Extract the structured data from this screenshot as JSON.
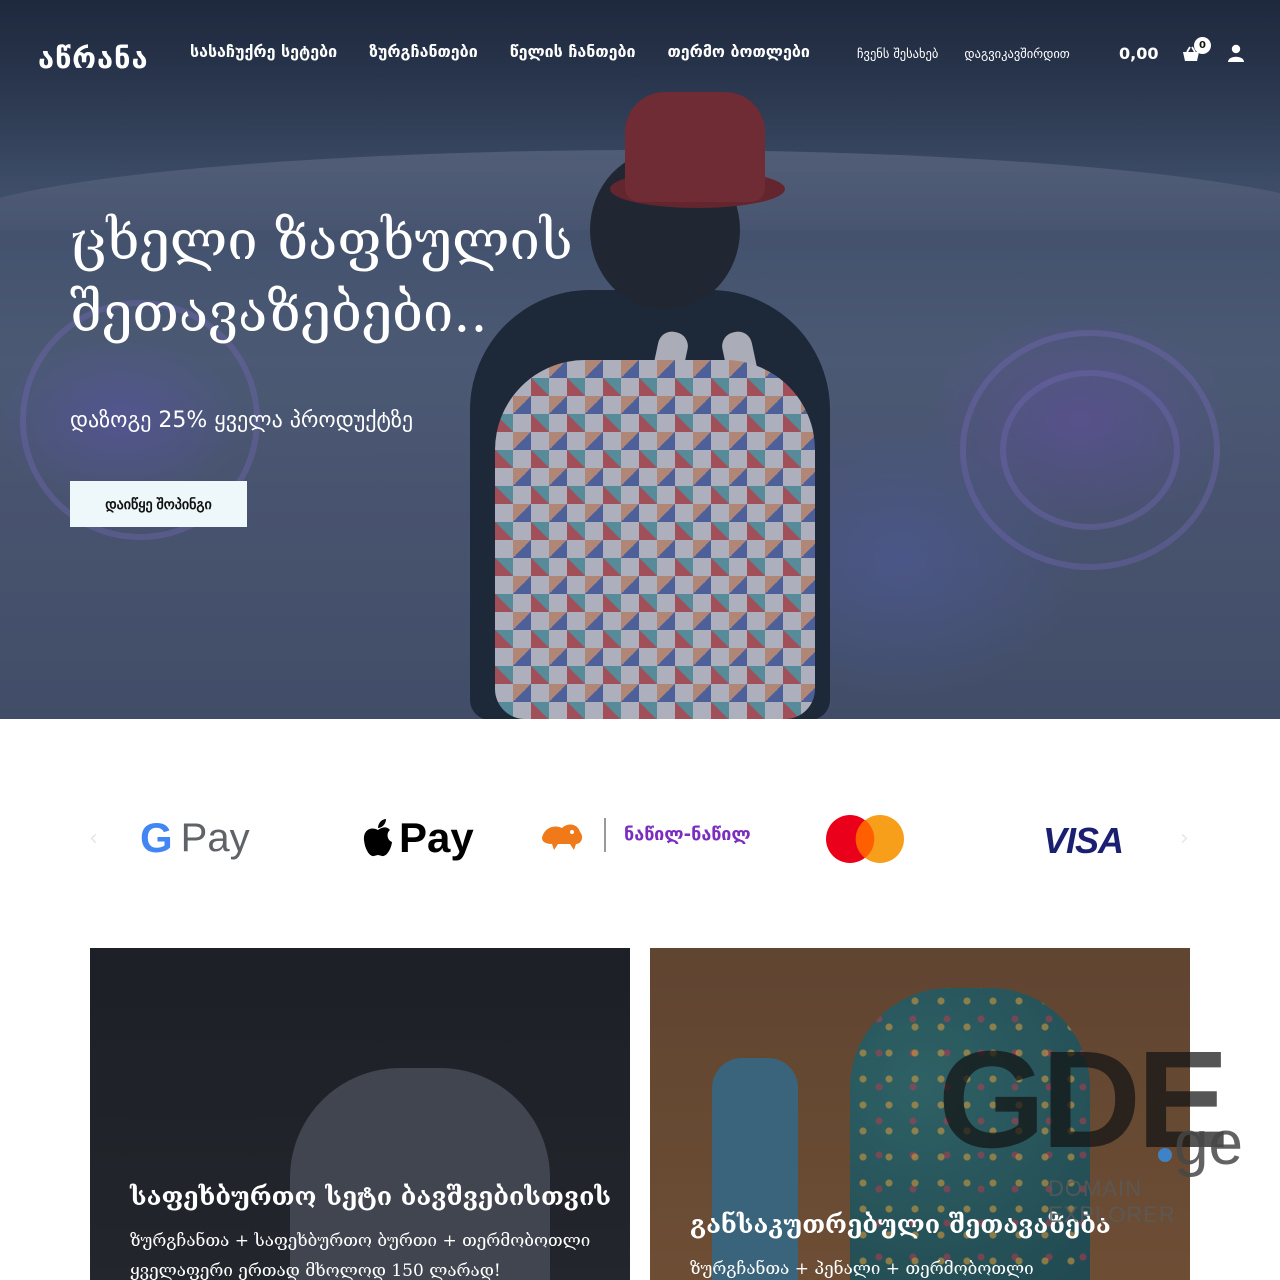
{
  "header": {
    "logo_text": "აწრანა",
    "main_nav": [
      "სასაჩუქრე სეტები",
      "ზურგჩანთები",
      "წელის ჩანთები",
      "თერმო ბოთლები"
    ],
    "secondary_nav": [
      "ჩვენს შესახებ",
      "დაგვიკავშირდით"
    ],
    "cart_total": "0,00 ",
    "cart_count": "0"
  },
  "hero": {
    "title": "ცხელი ზაფხულის შეთავაზებები..",
    "subtitle": "დაზოგე 25% ყველა პროდუქტზე",
    "cta": "დაიწყე შოპინგი"
  },
  "payments": {
    "items": [
      {
        "name": "Google Pay",
        "icon": "google-pay-logo",
        "text": "Pay"
      },
      {
        "name": "Apple Pay",
        "icon": "apple-pay-logo",
        "text": "Pay"
      },
      {
        "name": "Bank of Georgia",
        "icon": "bog-lion-logo",
        "text": "ნაწილ-ნაწილ"
      },
      {
        "name": "Mastercard",
        "icon": "mastercard-logo",
        "text": ""
      },
      {
        "name": "Visa",
        "icon": "visa-logo",
        "text": "VISA"
      }
    ],
    "gpay_g": "G"
  },
  "cards": [
    {
      "title": "საფეხბურთო სეტი ბავშვებისთვის",
      "line1": "ზურგჩანთა + საფეხბურთო ბურთი + თერმობოთლი",
      "line2": "ყველაფერი ერთად მხოლოდ 150 ლარად!"
    },
    {
      "title": "განსაკუთრებული შეთავაზება",
      "line1": "ზურგჩანთა + პენალი + თერმობოთლი"
    }
  ],
  "watermark": {
    "big": "GDE",
    "tld": "ge",
    "sub": "DOMAIN EXPLORER"
  },
  "colors": {
    "hero_button_bg": "#eef7f9",
    "visa_blue": "#1a1f71",
    "mc_red": "#eb001b",
    "mc_orange": "#f79e1b",
    "gde_dot": "#3f82c6"
  }
}
